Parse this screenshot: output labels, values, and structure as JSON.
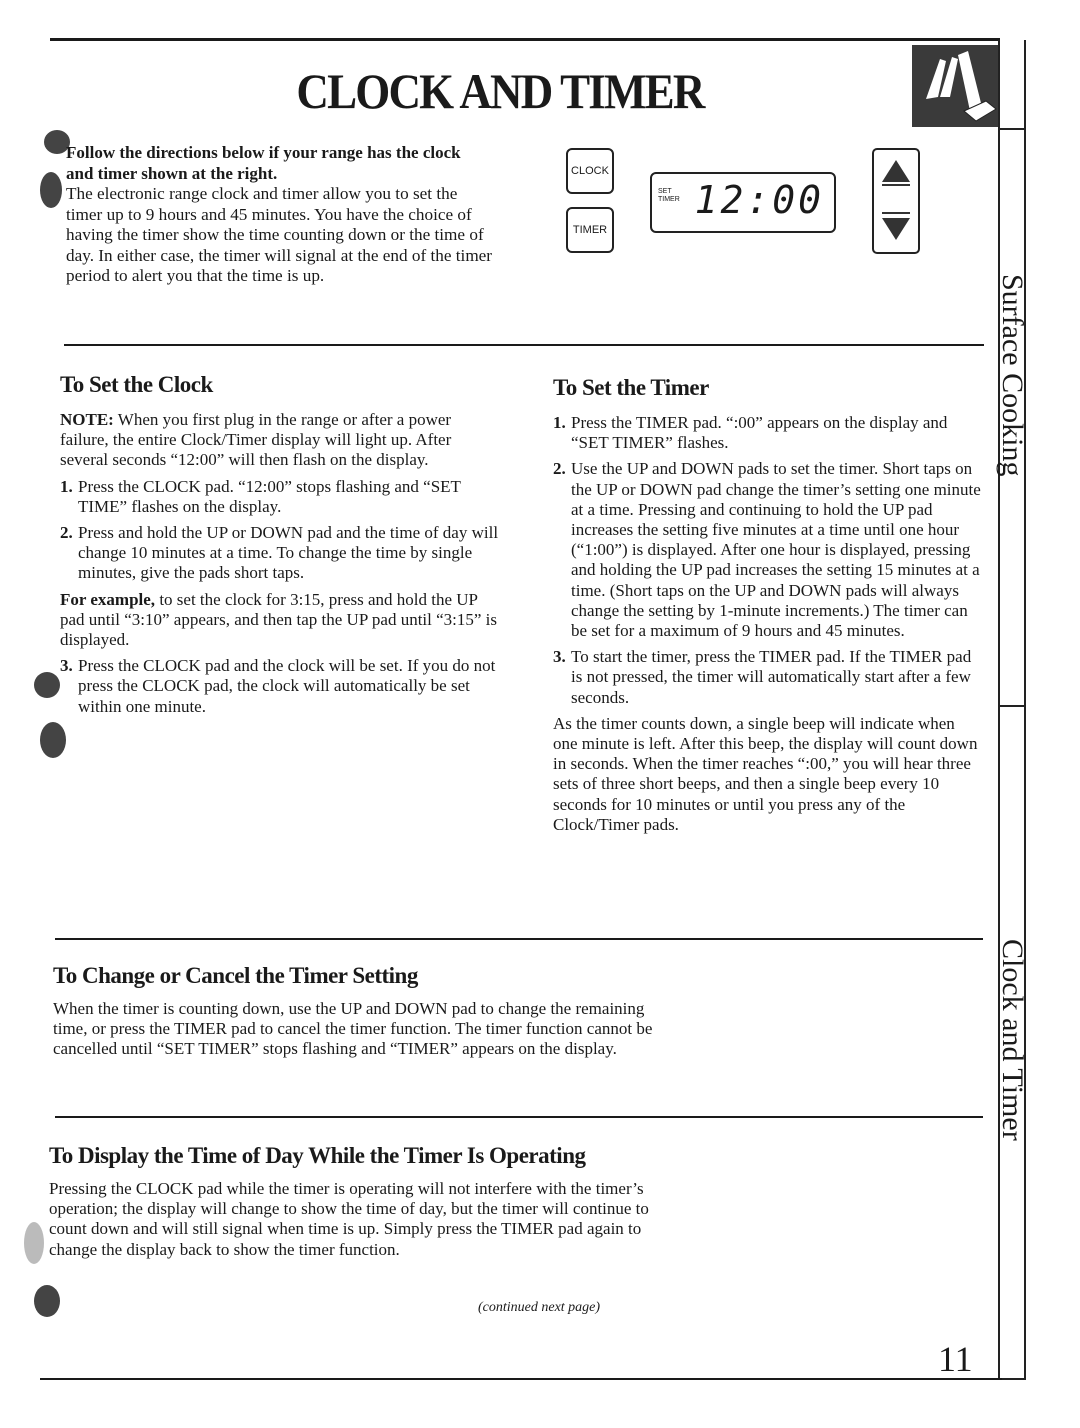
{
  "page": {
    "title": "CLOCK AND TIMER",
    "page_number": "11",
    "continued": "(continued next page)"
  },
  "side_tabs": {
    "surface_cooking": "Surface Cooking",
    "clock_and_timer": "Clock and Timer"
  },
  "intro": {
    "bold_note": "Follow the directions below if your range has the clock and timer shown at the right.",
    "body": "The electronic range clock and timer allow you to set the timer up to 9 hours and 45 minutes. You have the choice of having the timer show the time counting down or the time of day. In either case, the timer will signal at the end of the timer period to alert you that the time is up."
  },
  "control_panel": {
    "clock_pad": "CLOCK",
    "timer_pad": "TIMER",
    "display_label_1": "SET",
    "display_label_2": "TIMER",
    "display_value": "12:00",
    "up_icon": "up-arrow-icon",
    "down_icon": "down-arrow-icon"
  },
  "set_clock": {
    "heading": "To Set the Clock",
    "note_label": "NOTE:",
    "note_text": " When you first plug in the range or after a power failure, the entire Clock/Timer display will light up. After several seconds “12:00” will then flash on the display.",
    "steps": [
      {
        "num": "1.",
        "text": "Press the CLOCK pad. “12:00” stops flashing and “SET TIME” flashes on the display."
      },
      {
        "num": "2.",
        "text": "Press and hold the UP or DOWN pad and the time of day will change 10 minutes at a time. To change the time by single minutes, give the pads short taps."
      },
      {
        "num": "3.",
        "text": "Press the CLOCK pad and the clock will be set. If you do not press the CLOCK pad, the clock will automatically be set within one minute."
      }
    ],
    "example_label": "For example,",
    "example_text": " to set the clock for 3:15, press and hold the UP pad until “3:10” appears, and then tap the UP pad until “3:15” is displayed."
  },
  "set_timer": {
    "heading": "To Set the Timer",
    "steps": [
      {
        "num": "1.",
        "text": "Press the TIMER pad. “:00” appears on the display and “SET TIMER” flashes."
      },
      {
        "num": "2.",
        "text": "Use the UP and DOWN pads to set the timer. Short taps on the UP or DOWN pad change the timer’s setting one minute at a time. Pressing and continuing to hold the UP pad increases the setting five minutes at a time until one hour (“1:00”) is displayed. After one hour is displayed, pressing and holding the UP pad increases the setting 15 minutes at a time. (Short taps on the UP and DOWN pads will always change the setting by 1-minute increments.) The timer can be set for a maximum of 9 hours and 45 minutes."
      },
      {
        "num": "3.",
        "text": "To start the timer, press the TIMER pad. If the TIMER pad is not pressed, the timer will automatically start after a few seconds."
      }
    ],
    "countdown_text": "As the timer counts down, a single beep will indicate when one minute is left. After this beep, the display will count down in seconds. When the timer reaches “:00,” you will hear three sets of three short beeps, and then a single beep every 10 seconds for 10 minutes or until you press any of the Clock/Timer pads."
  },
  "change_cancel": {
    "heading": "To Change or Cancel the Timer Setting",
    "body": "When the timer is counting down, use the UP and DOWN pad to change the remaining time, or press the TIMER pad to cancel the timer function. The timer function cannot be cancelled until “SET TIMER” stops flashing and “TIMER” appears on the display."
  },
  "display_time_of_day": {
    "heading": "To Display the Time of Day While the Timer Is Operating",
    "body": "Pressing the CLOCK pad while the timer is operating will not interfere with the timer’s operation; the display will change to show the time of day, but the timer will continue to count down and will still signal when time is up. Simply press the TIMER pad again to change the display back to show the timer function."
  }
}
